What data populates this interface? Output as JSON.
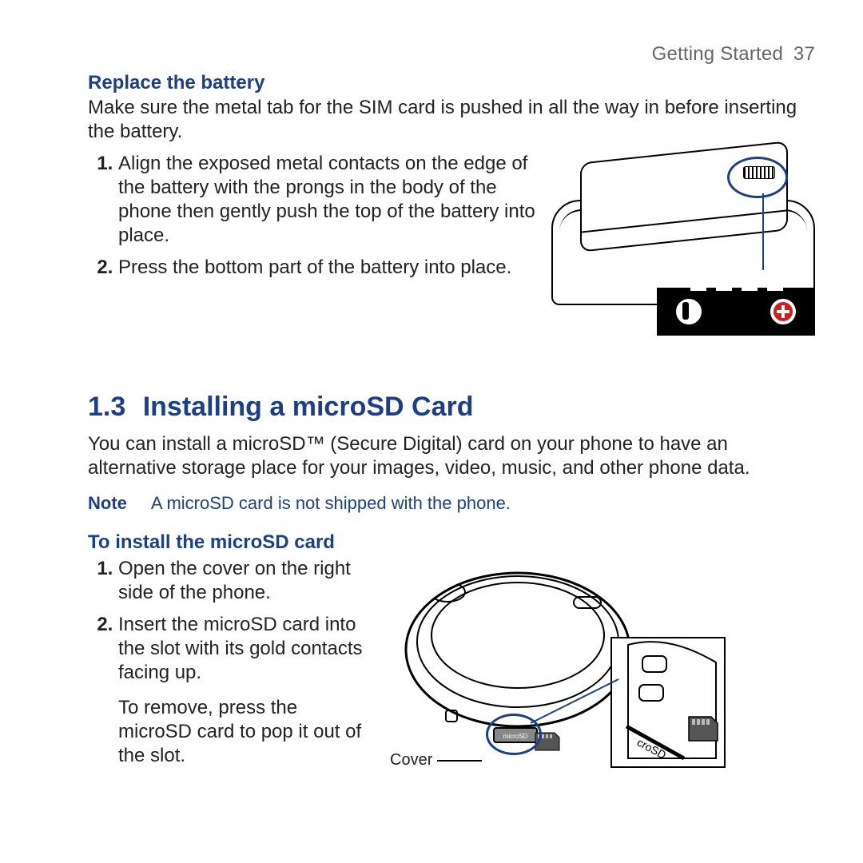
{
  "header": {
    "chapter": "Getting Started",
    "page": "37"
  },
  "battery": {
    "heading": "Replace the battery",
    "intro": "Make sure the metal tab for the SIM card is pushed in all the way in before inserting the battery.",
    "steps": [
      "Align the exposed metal contacts on the edge of the battery with the prongs in the body of the phone then gently push the top of the battery into place.",
      "Press the bottom part of the battery into place."
    ]
  },
  "section": {
    "number": "1.3",
    "title": "Installing a microSD Card"
  },
  "microsd": {
    "intro": "You can install a microSD™ (Secure Digital) card on your phone to have an alternative storage place for your images, video, music, and other phone data.",
    "note_label": "Note",
    "note_text": "A microSD card is not shipped with the phone.",
    "heading": "To install the microSD card",
    "steps": [
      "Open the cover on the right side of the phone.",
      "Insert the microSD card into the slot with its gold contacts facing up."
    ],
    "step2_extra": "To remove, press the microSD card to pop it out of the slot.",
    "cover_label": "Cover",
    "slot_label": "croSD"
  }
}
